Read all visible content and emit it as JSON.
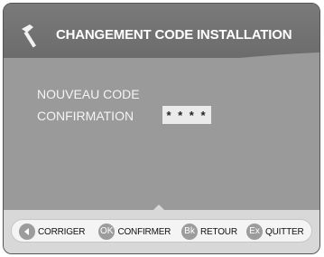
{
  "header": {
    "title": "CHANGEMENT CODE INSTALLATION",
    "icon": "hammer-icon"
  },
  "form": {
    "new_code_label": "NOUVEAU CODE",
    "confirm_label": "CONFIRMATION",
    "confirm_value": "* * * *"
  },
  "footer": {
    "buttons": [
      {
        "key": "",
        "icon": "left-arrow-icon",
        "label": "CORRIGER"
      },
      {
        "key": "OK",
        "label": "CONFIRMER"
      },
      {
        "key": "Bk",
        "label": "RETOUR"
      },
      {
        "key": "Ex",
        "label": "QUITTER"
      }
    ]
  },
  "colors": {
    "background": "#9a9a9a",
    "header": "#6c6c6c",
    "footer": "#d8d8d8",
    "badge": "#9c9c9c"
  }
}
